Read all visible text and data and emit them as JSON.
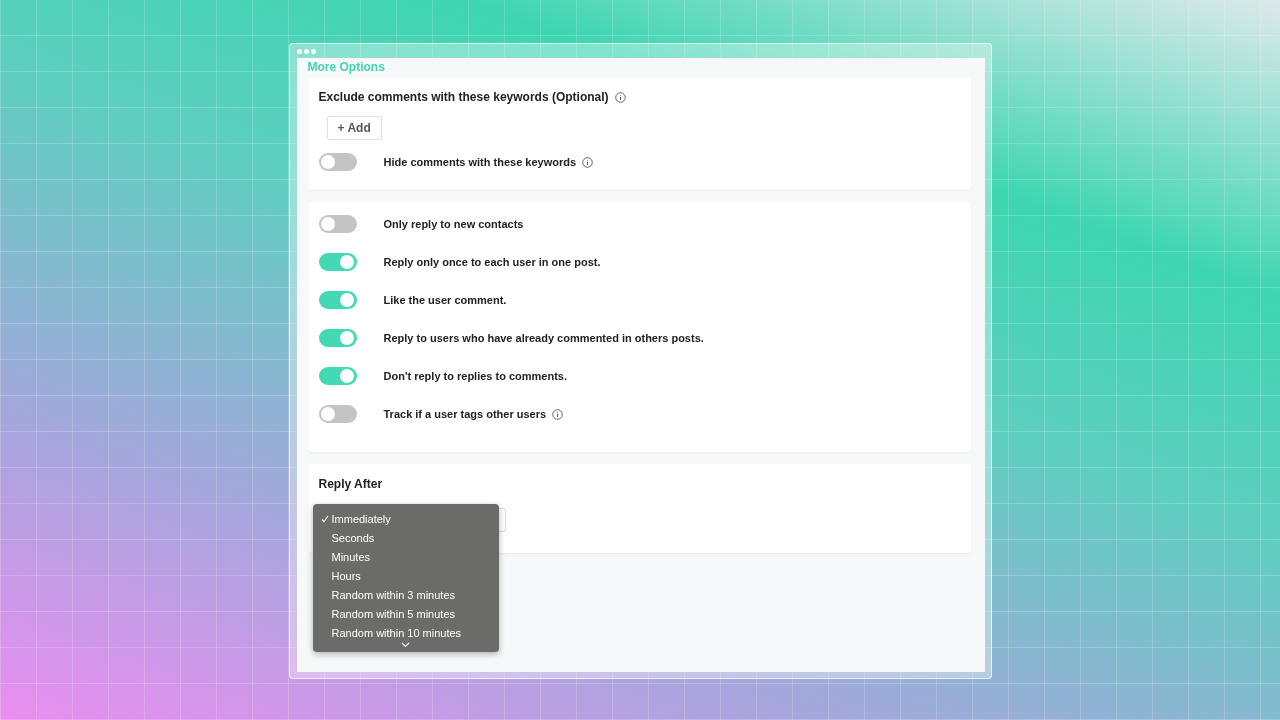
{
  "section_title": "More Options",
  "keywords": {
    "label": "Exclude comments with these keywords (Optional)",
    "info": true,
    "add_button": "+ Add",
    "hide_toggle": {
      "label": "Hide comments with these keywords",
      "on": false,
      "info": true
    }
  },
  "options": [
    {
      "label": "Only reply to new contacts",
      "on": false,
      "info": false
    },
    {
      "label": "Reply only once to each user in one post.",
      "on": true,
      "info": false
    },
    {
      "label": "Like the user comment.",
      "on": true,
      "info": false
    },
    {
      "label": "Reply to users who have already commented in others posts.",
      "on": true,
      "info": false
    },
    {
      "label": "Don't reply to replies to comments.",
      "on": true,
      "info": false
    },
    {
      "label": "Track if a user tags other users",
      "on": false,
      "info": true
    }
  ],
  "reply_after": {
    "label": "Reply After",
    "menu": [
      {
        "label": "Immediately",
        "selected": true
      },
      {
        "label": "Seconds",
        "selected": false
      },
      {
        "label": "Minutes",
        "selected": false
      },
      {
        "label": "Hours",
        "selected": false
      },
      {
        "label": "Random within 3 minutes",
        "selected": false
      },
      {
        "label": "Random within 5 minutes",
        "selected": false
      },
      {
        "label": "Random within 10 minutes",
        "selected": false
      }
    ]
  }
}
